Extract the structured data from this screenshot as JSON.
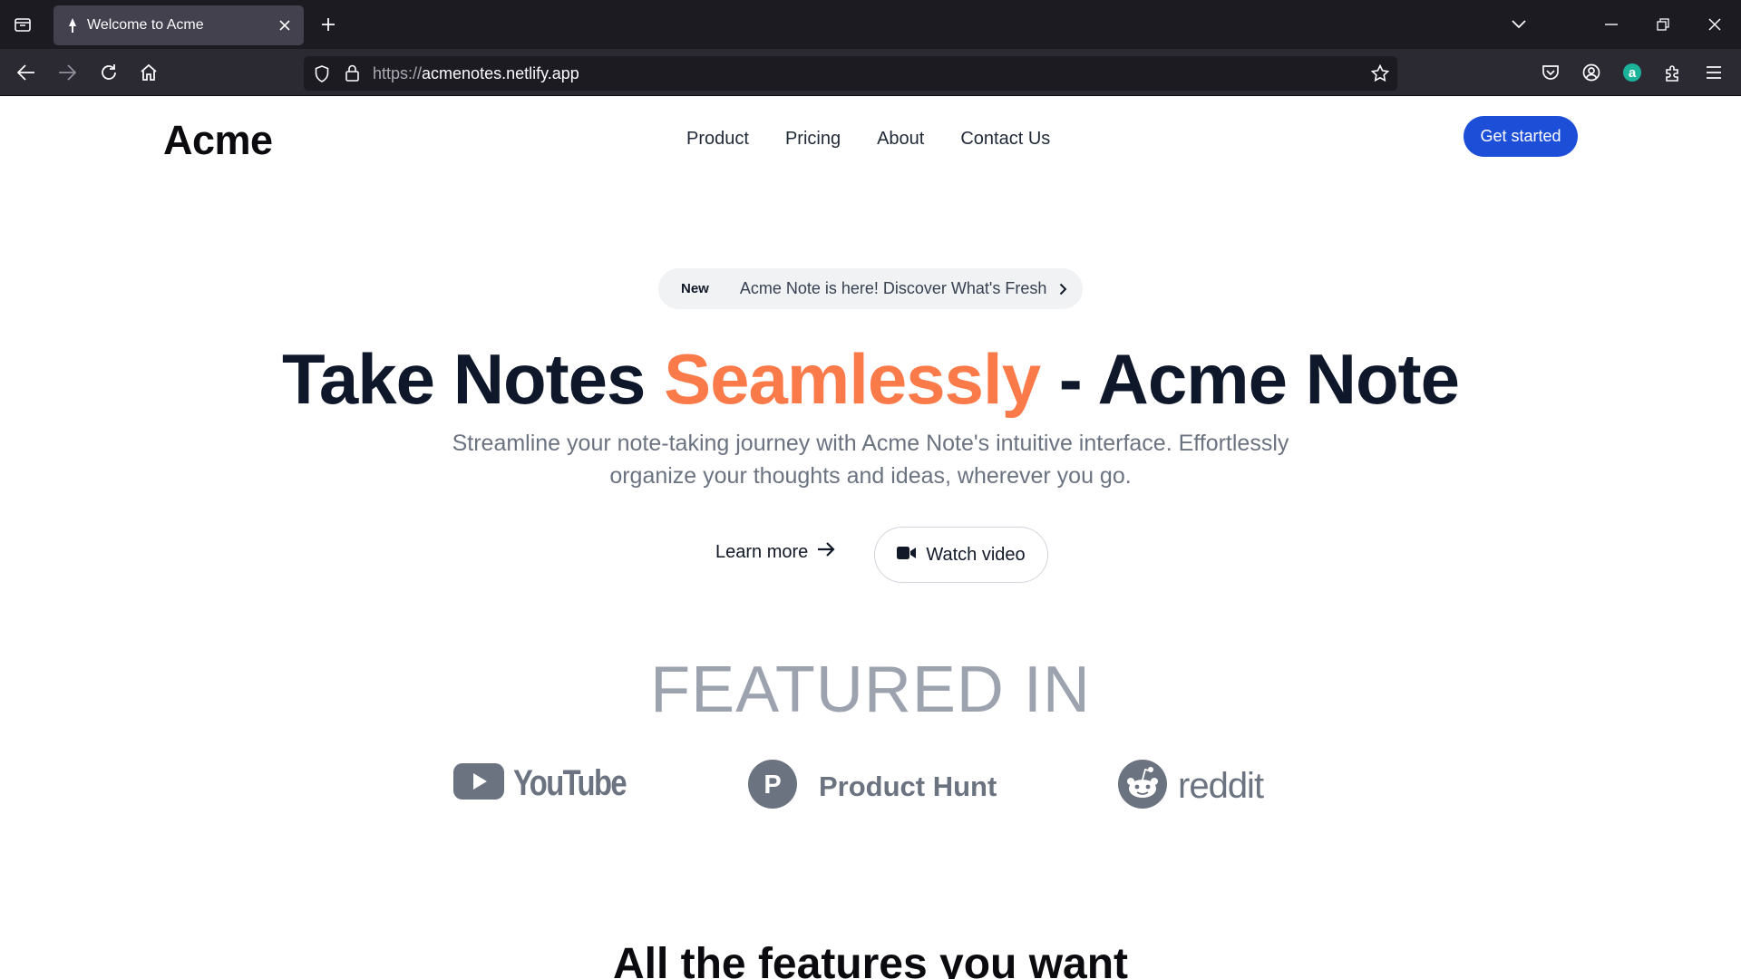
{
  "browser": {
    "tab_title": "Welcome to Acme",
    "url_scheme": "https://",
    "url_host": "acmenotes.netlify.app"
  },
  "header": {
    "logo": "Acme",
    "nav": [
      "Product",
      "Pricing",
      "About",
      "Contact Us"
    ],
    "cta_label": "Get started"
  },
  "announcement": {
    "badge": "New",
    "text": "Acme Note is here! Discover What's Fresh"
  },
  "hero": {
    "title_part1": "Take Notes ",
    "title_accent": "Seamlessly",
    "title_part2": " - Acme Note",
    "subtitle": "Streamline your note-taking journey with Acme Note's intuitive interface. Effortlessly organize your thoughts and ideas, wherever you go.",
    "learn_more_label": "Learn more",
    "watch_video_label": "Watch video",
    "accent_color": "#fb7a4a"
  },
  "featured": {
    "heading": "FEATURED IN",
    "brands": [
      "YouTube",
      "Product Hunt",
      "reddit"
    ]
  },
  "features": {
    "heading": "All the features you want"
  },
  "colors": {
    "primary": "#1d4ed8",
    "tabbar": "#1c1b22",
    "navbar": "#2b2a33"
  }
}
